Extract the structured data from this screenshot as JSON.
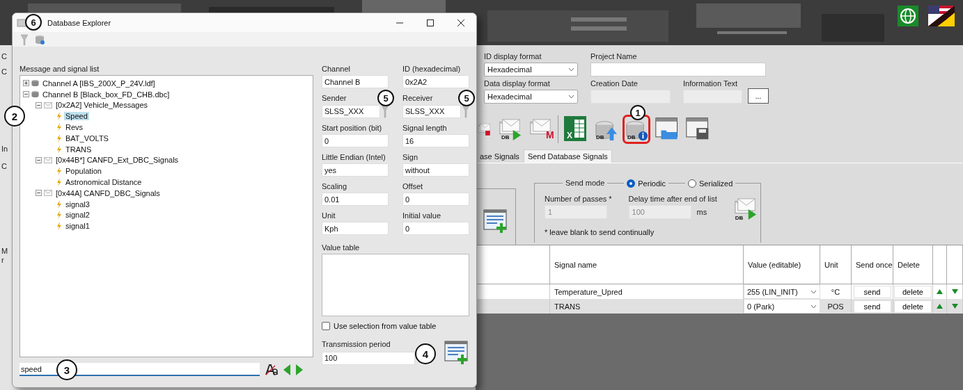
{
  "main_window": {
    "left_edge_fragments": [
      "C",
      "C",
      "In",
      "C",
      "M",
      "r"
    ],
    "id_display_format": {
      "label": "ID display format",
      "value": "Hexadecimal"
    },
    "project_name": {
      "label": "Project Name"
    },
    "data_display_format": {
      "label": "Data display format",
      "value": "Hexadecimal"
    },
    "creation_date": {
      "label": "Creation Date",
      "disabled": true
    },
    "information_text": {
      "label": "Information Text",
      "disabled": true,
      "button": "..."
    },
    "toolbar": [
      {
        "kind": "mail_stop",
        "highlighted": false
      },
      {
        "kind": "mail_send",
        "badge": "DB",
        "highlighted": false
      },
      {
        "kind": "mail_m",
        "badge": "M",
        "highlighted": false
      },
      {
        "kind": "excel",
        "badge": "X",
        "highlighted": false
      },
      {
        "kind": "db_upload",
        "badge": "DB",
        "highlighted": false
      },
      {
        "kind": "db_info",
        "badge": "DB",
        "highlighted": true,
        "callout": "1"
      },
      {
        "kind": "window_open",
        "highlighted": false
      },
      {
        "kind": "window_save",
        "highlighted": false
      }
    ],
    "tabs": [
      {
        "label": "ase Signals",
        "selected": false
      },
      {
        "label": "Send Database Signals",
        "selected": true
      }
    ],
    "send_mode": {
      "legend": "Send mode",
      "options": [
        {
          "label": "Periodic",
          "selected": true
        },
        {
          "label": "Serialized",
          "selected": false
        }
      ],
      "passes": {
        "label": "Number of passes *",
        "value": "1",
        "disabled": true
      },
      "delay": {
        "label": "Delay time after end of list",
        "value": "100",
        "unit": "ms",
        "disabled": true
      },
      "send_badge": "DB",
      "note": "* leave blank to send continually"
    },
    "table": {
      "columns": [
        "Signal name",
        "Value (editable)",
        "Unit",
        "Send once",
        "Delete"
      ],
      "rows": [
        {
          "signal": "Temperature_Upred",
          "value": "255  (LIN_INIT)",
          "unit": "°C",
          "send": "send",
          "delete": "delete",
          "selected": false
        },
        {
          "signal": "TRANS",
          "value": "0  (Park)",
          "unit": "POS",
          "send": "send",
          "delete": "delete",
          "selected": true
        }
      ]
    }
  },
  "dialog": {
    "title": "Database Explorer",
    "callout": "6",
    "list_label": "Message and signal list",
    "tree_callout": "2",
    "tree": [
      {
        "label": "Channel A [IBS_200X_P_24V.ldf]",
        "kind": "channel",
        "expanded": false,
        "selected": false
      },
      {
        "label": "Channel B [Black_box_FD_CHB.dbc]",
        "kind": "channel",
        "expanded": true,
        "selected": false,
        "children": [
          {
            "label": "[0x2A2] Vehicle_Messages",
            "kind": "message",
            "expanded": true,
            "selected": false,
            "children": [
              {
                "label": "Speed",
                "kind": "signal",
                "selected": true
              },
              {
                "label": "Revs",
                "kind": "signal",
                "selected": false
              },
              {
                "label": "BAT_VOLTS",
                "kind": "signal",
                "selected": false
              },
              {
                "label": "TRANS",
                "kind": "signal",
                "selected": false
              }
            ]
          },
          {
            "label": "[0x44B*] CANFD_Ext_DBC_Signals",
            "kind": "message",
            "expanded": true,
            "selected": false,
            "children": [
              {
                "label": "Population",
                "kind": "signal",
                "selected": false
              },
              {
                "label": "Astronomical Distance",
                "kind": "signal",
                "selected": false
              }
            ]
          },
          {
            "label": "[0x44A] CANFD_DBC_Signals",
            "kind": "message",
            "expanded": true,
            "selected": false,
            "children": [
              {
                "label": "signal3",
                "kind": "signal",
                "selected": false
              },
              {
                "label": "signal2",
                "kind": "signal",
                "selected": false
              },
              {
                "label": "signal1",
                "kind": "signal",
                "selected": false
              }
            ]
          }
        ]
      }
    ],
    "search": {
      "value": "speed",
      "callout": "3"
    },
    "fields": [
      {
        "label": "Channel",
        "value": "Channel B",
        "kind": "text"
      },
      {
        "label": "ID (hexadecimal)",
        "value": "0x2A2",
        "kind": "text"
      },
      {
        "label": "Sender",
        "value": "SLSS_XXX",
        "kind": "filter",
        "callout": "5"
      },
      {
        "label": "Receiver",
        "value": "SLSS_XXX",
        "kind": "filter",
        "callout": "5"
      },
      {
        "label": "Start position (bit)",
        "value": "0",
        "kind": "text"
      },
      {
        "label": "Signal length",
        "value": "16",
        "kind": "text"
      },
      {
        "label": "Little Endian (Intel)",
        "value": "yes",
        "kind": "text"
      },
      {
        "label": "Sign",
        "value": "without",
        "kind": "text"
      },
      {
        "label": "Scaling",
        "value": "0.01",
        "kind": "text"
      },
      {
        "label": "Offset",
        "value": "0",
        "kind": "text"
      },
      {
        "label": "Unit",
        "value": "Kph",
        "kind": "text"
      },
      {
        "label": "Initial value",
        "value": "0",
        "kind": "text"
      }
    ],
    "value_table_label": "Value table",
    "use_selection": {
      "label": "Use selection from value table",
      "checked": false
    },
    "transmission": {
      "label": "Transmission period",
      "value": "100"
    },
    "add_callout": "4"
  }
}
